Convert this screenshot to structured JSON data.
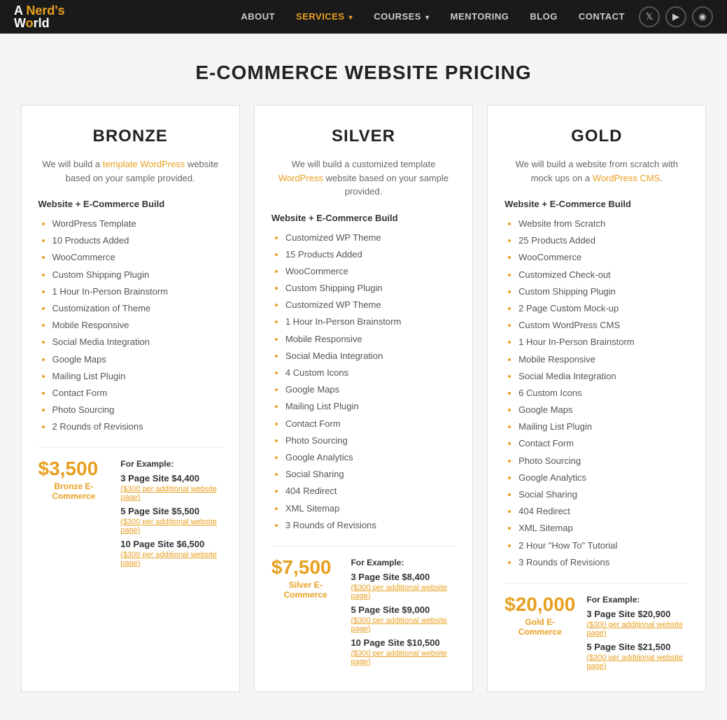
{
  "nav": {
    "logo_line1": "A Nerd's",
    "logo_line2": "World",
    "links": [
      {
        "label": "ABOUT",
        "active": false
      },
      {
        "label": "SERVICES",
        "active": true,
        "has_dropdown": true
      },
      {
        "label": "COURSES",
        "active": false,
        "has_dropdown": true
      },
      {
        "label": "MENTORING",
        "active": false
      },
      {
        "label": "BLOG",
        "active": false
      },
      {
        "label": "CONTACT",
        "active": false
      }
    ],
    "social": [
      {
        "name": "twitter",
        "icon": "𝕏"
      },
      {
        "name": "youtube",
        "icon": "▶"
      },
      {
        "name": "instagram",
        "icon": "◉"
      }
    ]
  },
  "page": {
    "title": "E-COMMERCE WEBSITE PRICING"
  },
  "plans": [
    {
      "id": "bronze",
      "title": "BRONZE",
      "desc_plain": "We will build a ",
      "desc_link": "template WordPress",
      "desc_end": " website based on your sample provided.",
      "section_label": "Website + E-Commerce Build",
      "features": [
        "WordPress Template",
        "10 Products Added",
        "WooCommerce",
        "Custom Shipping Plugin",
        "1 Hour In-Person Brainstorm",
        "Customization of Theme",
        "Mobile Responsive",
        "Social Media Integration",
        "Google Maps",
        "Mailing List Plugin",
        "Contact Form",
        "Photo Sourcing",
        "2 Rounds of Revisions"
      ],
      "big_price": "$3,500",
      "price_label": "Bronze E-Commerce",
      "example_label": "For Example:",
      "tiers": [
        {
          "name": "3 Page Site $4,400",
          "sub": "($300 per additional website page)"
        },
        {
          "name": "5 Page Site $5,500",
          "sub": "($300 per additional website page)"
        },
        {
          "name": "10 Page Site $6,500",
          "sub": "($300 per additional website page)"
        }
      ]
    },
    {
      "id": "silver",
      "title": "SILVER",
      "desc_plain": "We will build a customized template ",
      "desc_link": "WordPress",
      "desc_end": " website based on your sample provided.",
      "section_label": "Website + E-Commerce Build",
      "features": [
        "Customized WP Theme",
        "15 Products Added",
        "WooCommerce",
        "Custom Shipping Plugin",
        "Customized WP Theme",
        "1 Hour In-Person Brainstorm",
        "Mobile Responsive",
        "Social Media Integration",
        "4 Custom Icons",
        "Google Maps",
        "Mailing List Plugin",
        "Contact Form",
        "Photo Sourcing",
        "Google Analytics",
        "Social Sharing",
        "404 Redirect",
        "XML Sitemap",
        "3 Rounds of Revisions"
      ],
      "big_price": "$7,500",
      "price_label": "Silver E-Commerce",
      "example_label": "For Example:",
      "tiers": [
        {
          "name": "3 Page Site $8,400",
          "sub": "($300 per additional website page)"
        },
        {
          "name": "5 Page Site $9,000",
          "sub": "($300 per additional website page)"
        },
        {
          "name": "10 Page Site $10,500",
          "sub": "($300 per additional website page)"
        }
      ]
    },
    {
      "id": "gold",
      "title": "GOLD",
      "desc_plain": "We will build a website from scratch with mock ups on a ",
      "desc_link": "WordPress CMS",
      "desc_end": ".",
      "section_label": "Website + E-Commerce Build",
      "features": [
        "Website from Scratch",
        "25 Products Added",
        "WooCommerce",
        "Customized Check-out",
        "Custom Shipping Plugin",
        "2 Page Custom Mock-up",
        "Custom WordPress CMS",
        "1 Hour In-Person Brainstorm",
        "Mobile Responsive",
        "Social Media Integration",
        "6 Custom Icons",
        "Google Maps",
        "Mailing List Plugin",
        "Contact Form",
        "Photo Sourcing",
        "Google Analytics",
        "Social Sharing",
        "404 Redirect",
        "XML Sitemap",
        "2 Hour \"How To\" Tutorial",
        "3 Rounds of Revisions"
      ],
      "big_price": "$20,000",
      "price_label": "Gold E-Commerce",
      "example_label": "For Example:",
      "tiers": [
        {
          "name": "3 Page Site $20,900",
          "sub": "($300 per additional website page)"
        },
        {
          "name": "5 Page Site $21,500",
          "sub": "($300 per additional website page)"
        }
      ]
    }
  ]
}
